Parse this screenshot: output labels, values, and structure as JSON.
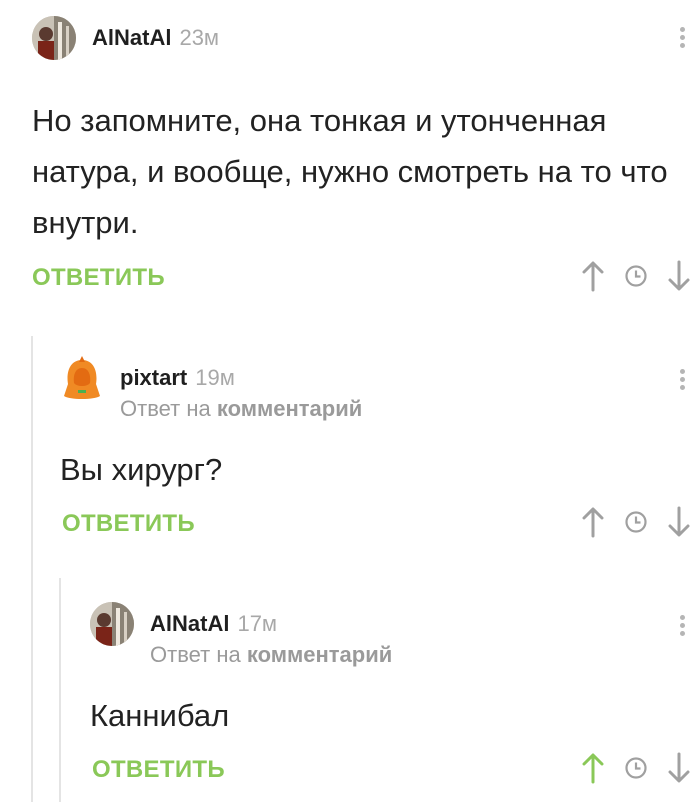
{
  "comments": [
    {
      "author": "AlNatAl",
      "time": "23м",
      "text": "Но запомните, она тонкая и утонченная натура, и вообще, нужно смотреть на то что внутри.",
      "reply_label": "ОТВЕТИТЬ",
      "avatar_icon": "user-photo-avatar",
      "up_active": false
    },
    {
      "author": "pixtart",
      "time": "19м",
      "reply_prefix": "Ответ на",
      "reply_target": "комментарий",
      "text": "Вы хирург?",
      "reply_label": "ОТВЕТИТЬ",
      "avatar_icon": "orange-hoodie-avatar",
      "up_active": false
    },
    {
      "author": "AlNatAl",
      "time": "17м",
      "reply_prefix": "Ответ на",
      "reply_target": "комментарий",
      "text": "Каннибал",
      "reply_label": "ОТВЕТИТЬ",
      "avatar_icon": "user-photo-avatar",
      "up_active": true
    }
  ],
  "colors": {
    "accent": "#8ac858",
    "muted": "#a8a8a8",
    "icon_gray": "#a0a0a0",
    "thread_line": "#e4e4e4"
  },
  "icons": [
    "more-vertical-icon",
    "arrow-up-icon",
    "clock-icon",
    "arrow-down-icon"
  ]
}
